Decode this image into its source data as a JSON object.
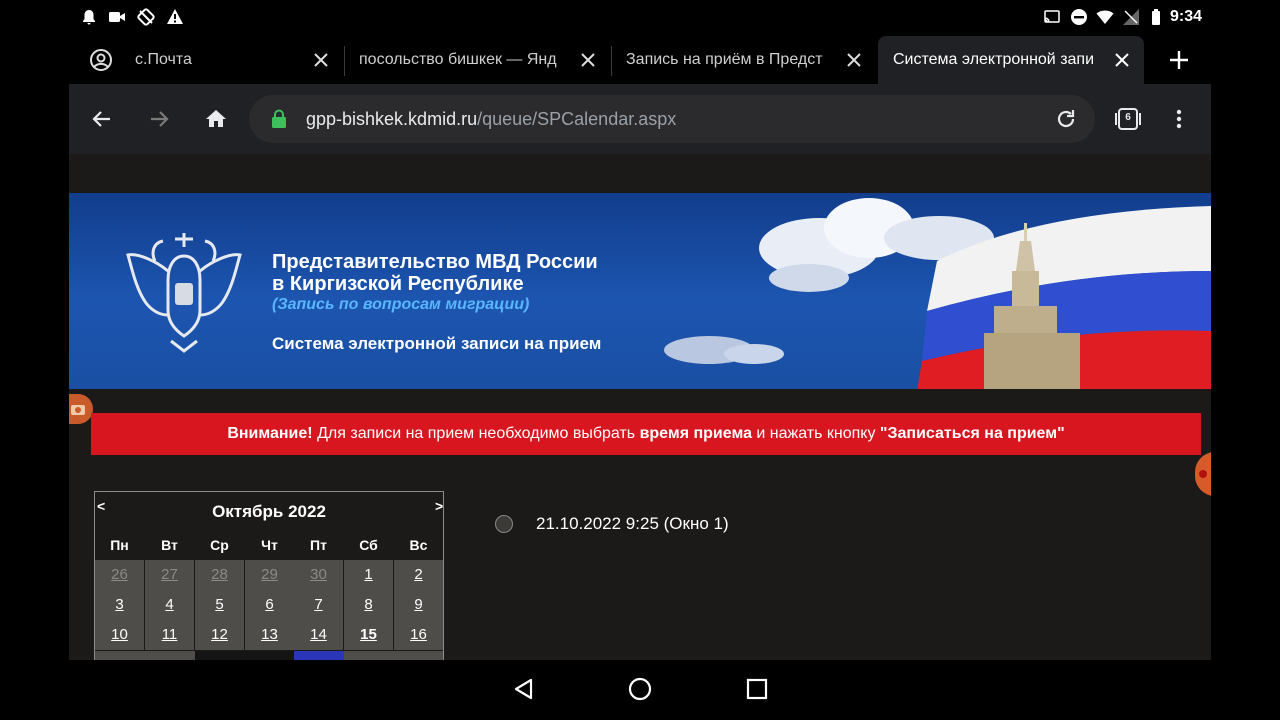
{
  "status": {
    "time": "9:34"
  },
  "tabs": [
    {
      "title": "с.Почта"
    },
    {
      "title": "посольство бишкек — Янд"
    },
    {
      "title": "Запись на приём в Предст"
    },
    {
      "title": "Система электронной запи"
    }
  ],
  "toolbar": {
    "url_host": "gpp-bishkek.kdmid.ru",
    "url_path": "/queue/SPCalendar.aspx",
    "tab_count": "6"
  },
  "banner": {
    "org_line1": "Представительство МВД России",
    "org_line2": "в Киргизской Республике",
    "subtitle": "(Запись по вопросам миграции)",
    "system_title": "Система электронной записи на прием"
  },
  "alert": {
    "prefix": "Внимание!",
    "text1": " Для записи на прием необходимо выбрать ",
    "bold1": "время приема",
    "text2": " и нажать кнопку ",
    "bold2": "\"Записаться на прием\""
  },
  "calendar": {
    "month": "Октябрь 2022",
    "prev": "<",
    "next": ">",
    "weekdays": [
      "Пн",
      "Вт",
      "Ср",
      "Чт",
      "Пт",
      "Сб",
      "Вс"
    ],
    "weeks": [
      [
        "26",
        "27",
        "28",
        "29",
        "30",
        "1",
        "2"
      ],
      [
        "3",
        "4",
        "5",
        "6",
        "7",
        "8",
        "9"
      ],
      [
        "10",
        "11",
        "12",
        "13",
        "14",
        "15",
        "16"
      ]
    ]
  },
  "slot": {
    "label": "21.10.2022 9:25 (Окно 1)"
  },
  "colors": {
    "alert": "#d7161f",
    "banner": "#1c55b0",
    "calendar_cell": "#4e4d49"
  }
}
